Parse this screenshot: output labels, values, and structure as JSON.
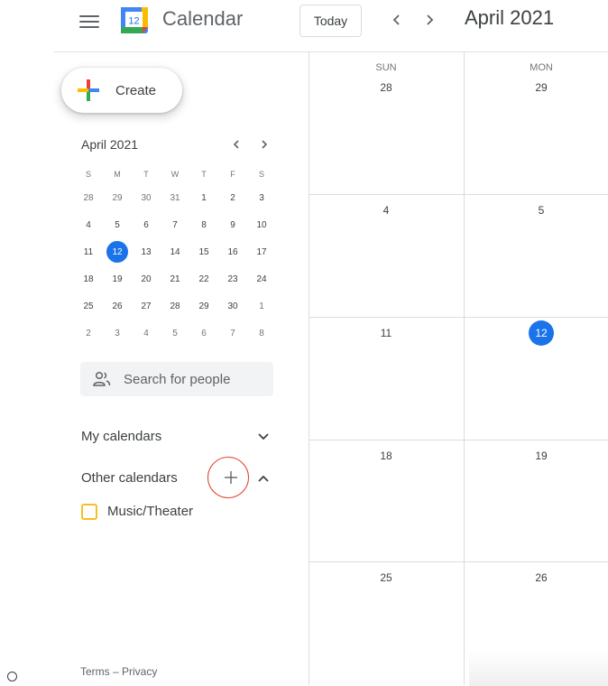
{
  "header": {
    "app_title": "Calendar",
    "logo_day": "12",
    "today_label": "Today",
    "prev_label": "‹",
    "next_label": "›",
    "current_month": "April 2021"
  },
  "sidebar": {
    "create_label": "Create",
    "mini_calendar": {
      "title": "April 2021",
      "prev_label": "‹",
      "next_label": "›",
      "weekdays": [
        "S",
        "M",
        "T",
        "W",
        "T",
        "F",
        "S"
      ],
      "weeks": [
        [
          "28",
          "29",
          "30",
          "31",
          "1",
          "2",
          "3"
        ],
        [
          "4",
          "5",
          "6",
          "7",
          "8",
          "9",
          "10"
        ],
        [
          "11",
          "12",
          "13",
          "14",
          "15",
          "16",
          "17"
        ],
        [
          "18",
          "19",
          "20",
          "21",
          "22",
          "23",
          "24"
        ],
        [
          "25",
          "26",
          "27",
          "28",
          "29",
          "30",
          "1"
        ],
        [
          "2",
          "3",
          "4",
          "5",
          "6",
          "7",
          "8"
        ]
      ],
      "today": "12"
    },
    "search_placeholder": "Search for people",
    "my_calendars_label": "My calendars",
    "other_calendars_label": "Other calendars",
    "other_calendars": [
      {
        "name": "Music/Theater",
        "color": "#f6bf26"
      }
    ],
    "footer": "Terms – Privacy"
  },
  "month_view": {
    "columns": [
      {
        "weekday": "SUN",
        "dates": [
          "28",
          "4",
          "11",
          "18",
          "25"
        ]
      },
      {
        "weekday": "MON",
        "dates": [
          "29",
          "5",
          "12",
          "19",
          "26"
        ]
      }
    ],
    "today": "12"
  },
  "colors": {
    "accent": "#1a73e8",
    "highlight_ring": "#e0402a",
    "grid_line": "#dadce0"
  }
}
